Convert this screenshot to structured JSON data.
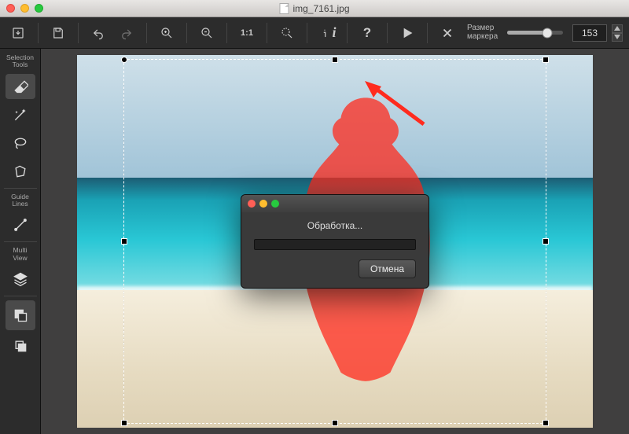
{
  "window": {
    "filename": "img_7161.jpg"
  },
  "toolbar": {
    "marker_label": "Размер\nмаркера",
    "marker_value": "153",
    "slider_percent": 72
  },
  "sidebar": {
    "section_selection": "Selection\nTools",
    "section_guides": "Guide\nLines",
    "section_multiview": "Multi\nView"
  },
  "dialog": {
    "title": "Обработка...",
    "cancel": "Отмена"
  }
}
